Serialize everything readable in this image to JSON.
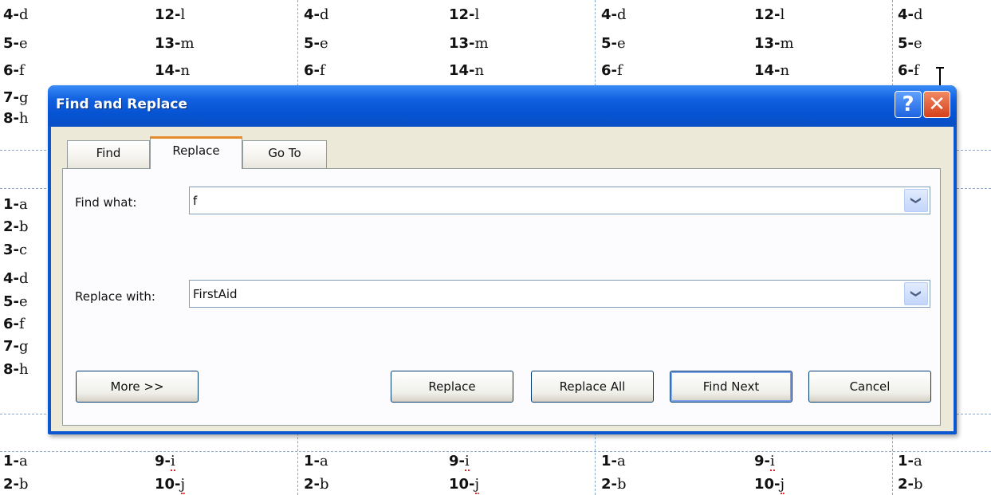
{
  "document": {
    "top_rows": [
      [
        "4-",
        "d",
        "12-",
        "l",
        "4-",
        "d",
        "12-",
        "l",
        "4-",
        "d",
        "12-",
        "l",
        "4-",
        "d"
      ],
      [
        "5-",
        "e",
        "13-",
        "m",
        "5-",
        "e",
        "13-",
        "m",
        "5-",
        "e",
        "13-",
        "m",
        "5-",
        "e"
      ],
      [
        "6-",
        "f",
        "14-",
        "n",
        "6-",
        "f",
        "14-",
        "n",
        "6-",
        "f",
        "14-",
        "n",
        "6-",
        "f"
      ]
    ],
    "left_column": [
      [
        "7-",
        "g"
      ],
      [
        "8-",
        "h"
      ],
      [
        "1-",
        "a"
      ],
      [
        "2-",
        "b"
      ],
      [
        "3-",
        "c"
      ],
      [
        "4-",
        "d"
      ],
      [
        "5-",
        "e"
      ],
      [
        "6-",
        "f"
      ],
      [
        "7-",
        "g"
      ],
      [
        "8-",
        "h"
      ]
    ],
    "bottom_rows": [
      [
        "1-",
        "a",
        "9-",
        "i",
        "1-",
        "a",
        "9-",
        "i",
        "1-",
        "a",
        "9-",
        "i",
        "1-",
        "a"
      ],
      [
        "2-",
        "b",
        "10-",
        "j",
        "2-",
        "b",
        "10-",
        "j",
        "2-",
        "b",
        "10-",
        "j",
        "2-",
        "b"
      ]
    ]
  },
  "dialog": {
    "title": "Find and Replace",
    "help_glyph": "?",
    "close_glyph": "✕",
    "tabs": [
      {
        "label": "Find",
        "active": false
      },
      {
        "label": "Replace",
        "active": true
      },
      {
        "label": "Go To",
        "active": false
      }
    ],
    "find_what": {
      "label": "Find what:",
      "value": "f"
    },
    "replace_with": {
      "label": "Replace with:",
      "value": "FirstAid"
    },
    "buttons": {
      "more": "More >>",
      "replace": "Replace",
      "replace_all": "Replace All",
      "find_next": "Find Next",
      "cancel": "Cancel"
    },
    "dropdown_glyph": "❯"
  }
}
